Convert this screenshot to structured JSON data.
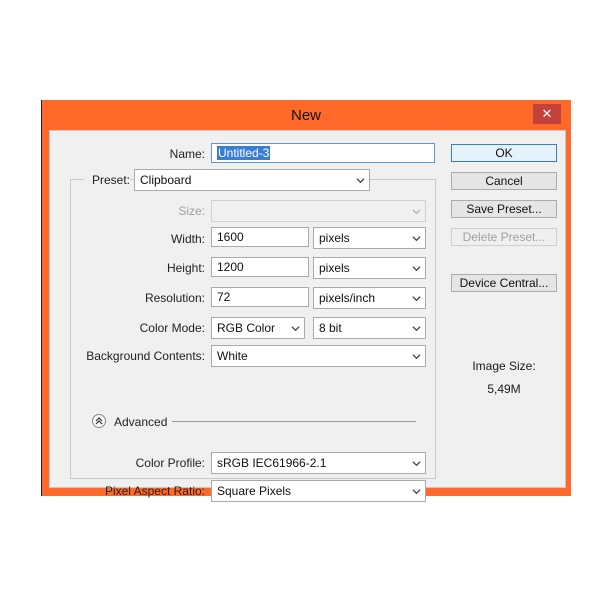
{
  "window": {
    "title": "New",
    "close_glyph": "✕"
  },
  "form": {
    "name_label": "Name:",
    "name_value": "Untitled-3",
    "preset_label": "Preset:",
    "preset_value": "Clipboard",
    "size_label": "Size:",
    "size_value": "",
    "width_label": "Width:",
    "width_value": "1600",
    "width_unit": "pixels",
    "height_label": "Height:",
    "height_value": "1200",
    "height_unit": "pixels",
    "resolution_label": "Resolution:",
    "resolution_value": "72",
    "resolution_unit": "pixels/inch",
    "color_mode_label": "Color Mode:",
    "color_mode_value": "RGB Color",
    "bit_depth_value": "8 bit",
    "background_label": "Background Contents:",
    "background_value": "White",
    "advanced_label": "Advanced",
    "color_profile_label": "Color Profile:",
    "color_profile_value": "sRGB IEC61966-2.1",
    "pixel_aspect_label": "Pixel Aspect Ratio:",
    "pixel_aspect_value": "Square Pixels"
  },
  "buttons": {
    "ok": "OK",
    "cancel": "Cancel",
    "save_preset": "Save Preset...",
    "delete_preset": "Delete Preset...",
    "device_central": "Device Central..."
  },
  "image_size": {
    "label": "Image Size:",
    "value": "5,49M"
  },
  "colors": {
    "window_frame": "#ff6a2b",
    "close_button": "#c2413b",
    "selection": "#3a7dd4"
  },
  "icons": [
    "close-icon",
    "chevron-down-icon",
    "advanced-toggle-icon"
  ]
}
